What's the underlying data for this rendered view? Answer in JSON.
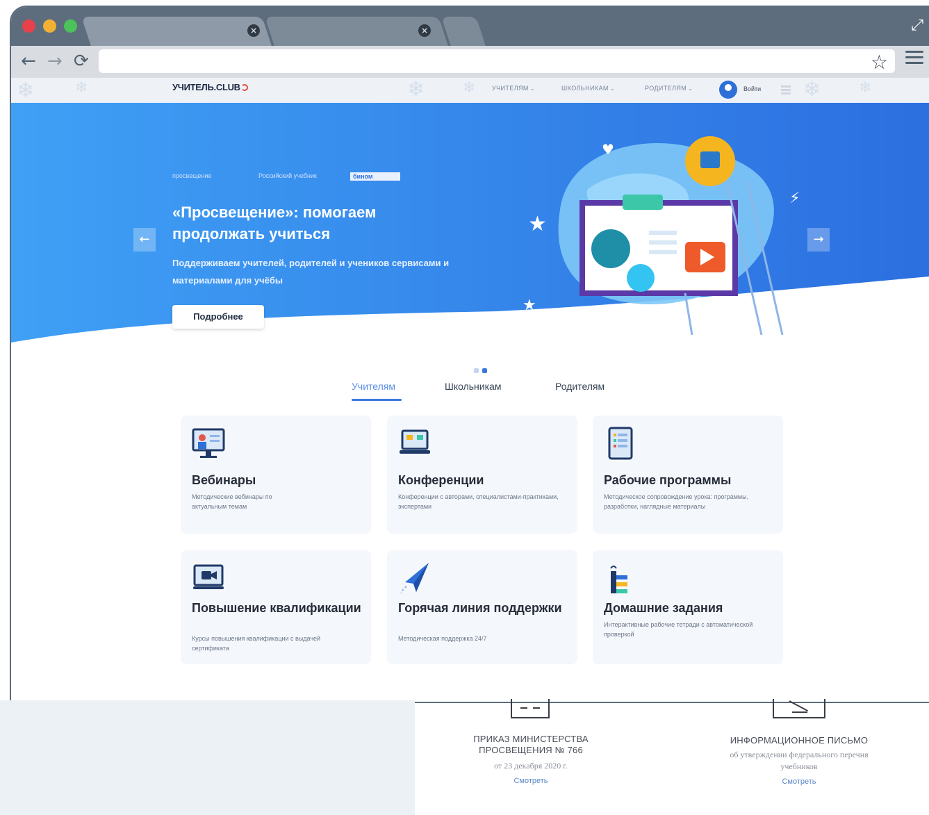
{
  "browser": {
    "traffic_lights": [
      "#e8414a",
      "#f2b134",
      "#4cc25a"
    ],
    "tabs": [
      {
        "close_glyph": "×"
      },
      {
        "close_glyph": "×"
      }
    ],
    "nav": {
      "back": "←",
      "forward": "→",
      "reload": "⟳"
    },
    "address": "",
    "star": "☆"
  },
  "site": {
    "logo": "УЧИТЕЛЬ.",
    "logo_suffix": "CLUB",
    "nav": [
      {
        "label": "УЧИТЕЛЯМ"
      },
      {
        "label": "ШКОЛЬНИКАМ"
      },
      {
        "label": "РОДИТЕЛЯМ"
      }
    ],
    "login": "Войти",
    "colors": {
      "hero_blue": "#3b8ef0",
      "accent": "#3a78e0",
      "card_bg": "#f4f7fc"
    }
  },
  "hero": {
    "partners": [
      "просвещение",
      "Российский учебник",
      "бином"
    ],
    "title": "«Просвещение»: помогаем продолжать учиться",
    "subtitle": "Поддерживаем учителей, родителей и учеников сервисами и материалами для учёбы",
    "button": "Подробнее",
    "prev": "←",
    "next": "→",
    "slides_total": 2,
    "active_slide": 2
  },
  "content_tabs": [
    {
      "label": "Учителям",
      "active": true
    },
    {
      "label": "Школьникам",
      "active": false
    },
    {
      "label": "Родителям",
      "active": false
    }
  ],
  "cards": [
    {
      "title": "Вебинары",
      "desc": "Методические вебинары по актуальным темам",
      "icon": "webinar-icon"
    },
    {
      "title": "Конференции",
      "desc": "Конференции с авторами, специалистами-практиками, экспертами",
      "icon": "laptop-icon"
    },
    {
      "title": "Рабочие программы",
      "desc": "Методическое сопровождение урока: программы, разработки, наглядные материалы",
      "icon": "tablet-icon"
    },
    {
      "title": "Повышение квалификации",
      "desc": "Курсы повышения квалификации с выдачей сертификата",
      "icon": "video-camera-icon"
    },
    {
      "title": "Горячая линия поддержки",
      "desc": "Методическая поддержка 24/7",
      "icon": "paper-plane-icon"
    },
    {
      "title": "Домашние задания",
      "desc": "Интерактивные рабочие тетради с автоматической проверкой",
      "icon": "homework-icon"
    }
  ],
  "documents": [
    {
      "title": "ПРИКАЗ МИНИСТЕРСТВА ПРОСВЕЩЕНИЯ № 766",
      "sub": "от 23 декабря 2020 г.",
      "link": "Смотреть"
    },
    {
      "title": "ИНФОРМАЦИОННОЕ ПИСЬМО",
      "sub": "об утверждении федерального перечня учебников",
      "link": "Смотреть"
    }
  ]
}
